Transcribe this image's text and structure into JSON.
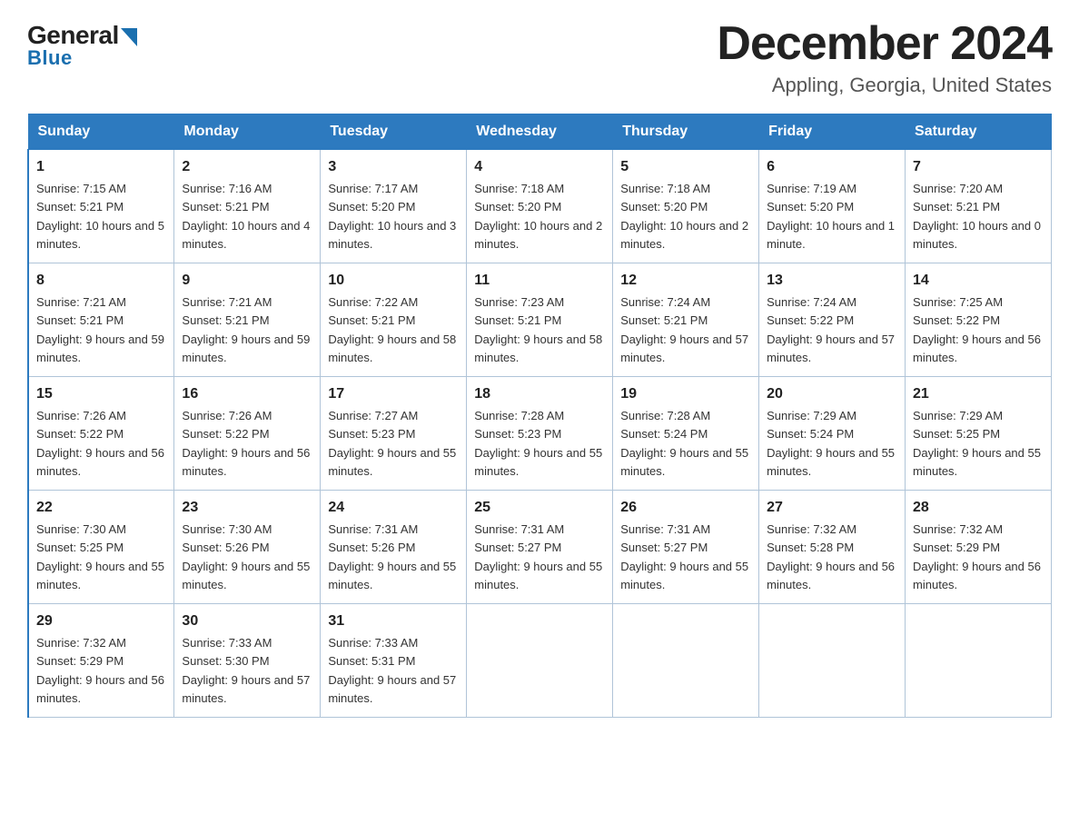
{
  "logo": {
    "general": "General",
    "blue": "Blue"
  },
  "title": "December 2024",
  "subtitle": "Appling, Georgia, United States",
  "days_of_week": [
    "Sunday",
    "Monday",
    "Tuesday",
    "Wednesday",
    "Thursday",
    "Friday",
    "Saturday"
  ],
  "weeks": [
    [
      {
        "day": "1",
        "sunrise": "7:15 AM",
        "sunset": "5:21 PM",
        "daylight": "10 hours and 5 minutes."
      },
      {
        "day": "2",
        "sunrise": "7:16 AM",
        "sunset": "5:21 PM",
        "daylight": "10 hours and 4 minutes."
      },
      {
        "day": "3",
        "sunrise": "7:17 AM",
        "sunset": "5:20 PM",
        "daylight": "10 hours and 3 minutes."
      },
      {
        "day": "4",
        "sunrise": "7:18 AM",
        "sunset": "5:20 PM",
        "daylight": "10 hours and 2 minutes."
      },
      {
        "day": "5",
        "sunrise": "7:18 AM",
        "sunset": "5:20 PM",
        "daylight": "10 hours and 2 minutes."
      },
      {
        "day": "6",
        "sunrise": "7:19 AM",
        "sunset": "5:20 PM",
        "daylight": "10 hours and 1 minute."
      },
      {
        "day": "7",
        "sunrise": "7:20 AM",
        "sunset": "5:21 PM",
        "daylight": "10 hours and 0 minutes."
      }
    ],
    [
      {
        "day": "8",
        "sunrise": "7:21 AM",
        "sunset": "5:21 PM",
        "daylight": "9 hours and 59 minutes."
      },
      {
        "day": "9",
        "sunrise": "7:21 AM",
        "sunset": "5:21 PM",
        "daylight": "9 hours and 59 minutes."
      },
      {
        "day": "10",
        "sunrise": "7:22 AM",
        "sunset": "5:21 PM",
        "daylight": "9 hours and 58 minutes."
      },
      {
        "day": "11",
        "sunrise": "7:23 AM",
        "sunset": "5:21 PM",
        "daylight": "9 hours and 58 minutes."
      },
      {
        "day": "12",
        "sunrise": "7:24 AM",
        "sunset": "5:21 PM",
        "daylight": "9 hours and 57 minutes."
      },
      {
        "day": "13",
        "sunrise": "7:24 AM",
        "sunset": "5:22 PM",
        "daylight": "9 hours and 57 minutes."
      },
      {
        "day": "14",
        "sunrise": "7:25 AM",
        "sunset": "5:22 PM",
        "daylight": "9 hours and 56 minutes."
      }
    ],
    [
      {
        "day": "15",
        "sunrise": "7:26 AM",
        "sunset": "5:22 PM",
        "daylight": "9 hours and 56 minutes."
      },
      {
        "day": "16",
        "sunrise": "7:26 AM",
        "sunset": "5:22 PM",
        "daylight": "9 hours and 56 minutes."
      },
      {
        "day": "17",
        "sunrise": "7:27 AM",
        "sunset": "5:23 PM",
        "daylight": "9 hours and 55 minutes."
      },
      {
        "day": "18",
        "sunrise": "7:28 AM",
        "sunset": "5:23 PM",
        "daylight": "9 hours and 55 minutes."
      },
      {
        "day": "19",
        "sunrise": "7:28 AM",
        "sunset": "5:24 PM",
        "daylight": "9 hours and 55 minutes."
      },
      {
        "day": "20",
        "sunrise": "7:29 AM",
        "sunset": "5:24 PM",
        "daylight": "9 hours and 55 minutes."
      },
      {
        "day": "21",
        "sunrise": "7:29 AM",
        "sunset": "5:25 PM",
        "daylight": "9 hours and 55 minutes."
      }
    ],
    [
      {
        "day": "22",
        "sunrise": "7:30 AM",
        "sunset": "5:25 PM",
        "daylight": "9 hours and 55 minutes."
      },
      {
        "day": "23",
        "sunrise": "7:30 AM",
        "sunset": "5:26 PM",
        "daylight": "9 hours and 55 minutes."
      },
      {
        "day": "24",
        "sunrise": "7:31 AM",
        "sunset": "5:26 PM",
        "daylight": "9 hours and 55 minutes."
      },
      {
        "day": "25",
        "sunrise": "7:31 AM",
        "sunset": "5:27 PM",
        "daylight": "9 hours and 55 minutes."
      },
      {
        "day": "26",
        "sunrise": "7:31 AM",
        "sunset": "5:27 PM",
        "daylight": "9 hours and 55 minutes."
      },
      {
        "day": "27",
        "sunrise": "7:32 AM",
        "sunset": "5:28 PM",
        "daylight": "9 hours and 56 minutes."
      },
      {
        "day": "28",
        "sunrise": "7:32 AM",
        "sunset": "5:29 PM",
        "daylight": "9 hours and 56 minutes."
      }
    ],
    [
      {
        "day": "29",
        "sunrise": "7:32 AM",
        "sunset": "5:29 PM",
        "daylight": "9 hours and 56 minutes."
      },
      {
        "day": "30",
        "sunrise": "7:33 AM",
        "sunset": "5:30 PM",
        "daylight": "9 hours and 57 minutes."
      },
      {
        "day": "31",
        "sunrise": "7:33 AM",
        "sunset": "5:31 PM",
        "daylight": "9 hours and 57 minutes."
      },
      null,
      null,
      null,
      null
    ]
  ],
  "labels": {
    "sunrise": "Sunrise:",
    "sunset": "Sunset:",
    "daylight": "Daylight:"
  }
}
